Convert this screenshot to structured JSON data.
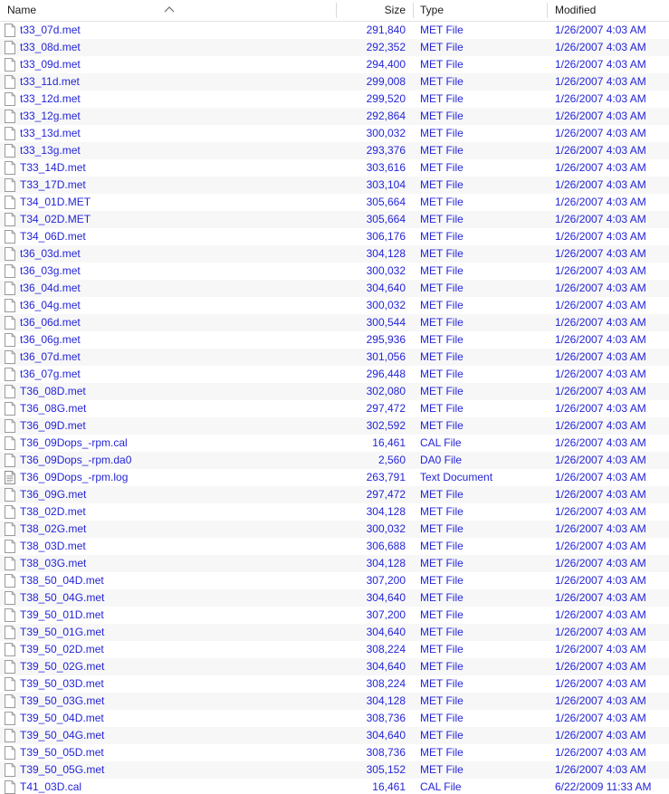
{
  "columns": {
    "name": "Name",
    "size": "Size",
    "type": "Type",
    "modified": "Modified",
    "sort_indicator": "sort-ascending-chevron",
    "sorted_by": "Name"
  },
  "theme": {
    "text_color": "#2424d8",
    "header_text_color": "#1b1b1b",
    "background": "#ffffff",
    "alt_row_background": "#f7f7f7",
    "divider_color": "#d9d9d9"
  },
  "files": [
    {
      "name": "t33_07d.met",
      "size": "291,840",
      "type": "MET File",
      "modified": "1/26/2007 4:03 AM",
      "icon": "blank-file-icon"
    },
    {
      "name": "t33_08d.met",
      "size": "292,352",
      "type": "MET File",
      "modified": "1/26/2007 4:03 AM",
      "icon": "blank-file-icon"
    },
    {
      "name": "t33_09d.met",
      "size": "294,400",
      "type": "MET File",
      "modified": "1/26/2007 4:03 AM",
      "icon": "blank-file-icon"
    },
    {
      "name": "t33_11d.met",
      "size": "299,008",
      "type": "MET File",
      "modified": "1/26/2007 4:03 AM",
      "icon": "blank-file-icon"
    },
    {
      "name": "t33_12d.met",
      "size": "299,520",
      "type": "MET File",
      "modified": "1/26/2007 4:03 AM",
      "icon": "blank-file-icon"
    },
    {
      "name": "t33_12g.met",
      "size": "292,864",
      "type": "MET File",
      "modified": "1/26/2007 4:03 AM",
      "icon": "blank-file-icon"
    },
    {
      "name": "t33_13d.met",
      "size": "300,032",
      "type": "MET File",
      "modified": "1/26/2007 4:03 AM",
      "icon": "blank-file-icon"
    },
    {
      "name": "t33_13g.met",
      "size": "293,376",
      "type": "MET File",
      "modified": "1/26/2007 4:03 AM",
      "icon": "blank-file-icon"
    },
    {
      "name": "T33_14D.met",
      "size": "303,616",
      "type": "MET File",
      "modified": "1/26/2007 4:03 AM",
      "icon": "blank-file-icon"
    },
    {
      "name": "T33_17D.met",
      "size": "303,104",
      "type": "MET File",
      "modified": "1/26/2007 4:03 AM",
      "icon": "blank-file-icon"
    },
    {
      "name": "T34_01D.MET",
      "size": "305,664",
      "type": "MET File",
      "modified": "1/26/2007 4:03 AM",
      "icon": "blank-file-icon"
    },
    {
      "name": "T34_02D.MET",
      "size": "305,664",
      "type": "MET File",
      "modified": "1/26/2007 4:03 AM",
      "icon": "blank-file-icon"
    },
    {
      "name": "T34_06D.met",
      "size": "306,176",
      "type": "MET File",
      "modified": "1/26/2007 4:03 AM",
      "icon": "blank-file-icon"
    },
    {
      "name": "t36_03d.met",
      "size": "304,128",
      "type": "MET File",
      "modified": "1/26/2007 4:03 AM",
      "icon": "blank-file-icon"
    },
    {
      "name": "t36_03g.met",
      "size": "300,032",
      "type": "MET File",
      "modified": "1/26/2007 4:03 AM",
      "icon": "blank-file-icon"
    },
    {
      "name": "t36_04d.met",
      "size": "304,640",
      "type": "MET File",
      "modified": "1/26/2007 4:03 AM",
      "icon": "blank-file-icon"
    },
    {
      "name": "t36_04g.met",
      "size": "300,032",
      "type": "MET File",
      "modified": "1/26/2007 4:03 AM",
      "icon": "blank-file-icon"
    },
    {
      "name": "t36_06d.met",
      "size": "300,544",
      "type": "MET File",
      "modified": "1/26/2007 4:03 AM",
      "icon": "blank-file-icon"
    },
    {
      "name": "t36_06g.met",
      "size": "295,936",
      "type": "MET File",
      "modified": "1/26/2007 4:03 AM",
      "icon": "blank-file-icon"
    },
    {
      "name": "t36_07d.met",
      "size": "301,056",
      "type": "MET File",
      "modified": "1/26/2007 4:03 AM",
      "icon": "blank-file-icon"
    },
    {
      "name": "t36_07g.met",
      "size": "296,448",
      "type": "MET File",
      "modified": "1/26/2007 4:03 AM",
      "icon": "blank-file-icon"
    },
    {
      "name": "T36_08D.met",
      "size": "302,080",
      "type": "MET File",
      "modified": "1/26/2007 4:03 AM",
      "icon": "blank-file-icon"
    },
    {
      "name": "T36_08G.met",
      "size": "297,472",
      "type": "MET File",
      "modified": "1/26/2007 4:03 AM",
      "icon": "blank-file-icon"
    },
    {
      "name": "T36_09D.met",
      "size": "302,592",
      "type": "MET File",
      "modified": "1/26/2007 4:03 AM",
      "icon": "blank-file-icon"
    },
    {
      "name": "T36_09Dops_-rpm.cal",
      "size": "16,461",
      "type": "CAL File",
      "modified": "1/26/2007 4:03 AM",
      "icon": "blank-file-icon"
    },
    {
      "name": "T36_09Dops_-rpm.da0",
      "size": "2,560",
      "type": "DA0 File",
      "modified": "1/26/2007 4:03 AM",
      "icon": "blank-file-icon"
    },
    {
      "name": "T36_09Dops_-rpm.log",
      "size": "263,791",
      "type": "Text Document",
      "modified": "1/26/2007 4:03 AM",
      "icon": "text-document-icon"
    },
    {
      "name": "T36_09G.met",
      "size": "297,472",
      "type": "MET File",
      "modified": "1/26/2007 4:03 AM",
      "icon": "blank-file-icon"
    },
    {
      "name": "T38_02D.met",
      "size": "304,128",
      "type": "MET File",
      "modified": "1/26/2007 4:03 AM",
      "icon": "blank-file-icon"
    },
    {
      "name": "T38_02G.met",
      "size": "300,032",
      "type": "MET File",
      "modified": "1/26/2007 4:03 AM",
      "icon": "blank-file-icon"
    },
    {
      "name": "T38_03D.met",
      "size": "306,688",
      "type": "MET File",
      "modified": "1/26/2007 4:03 AM",
      "icon": "blank-file-icon"
    },
    {
      "name": "T38_03G.met",
      "size": "304,128",
      "type": "MET File",
      "modified": "1/26/2007 4:03 AM",
      "icon": "blank-file-icon"
    },
    {
      "name": "T38_50_04D.met",
      "size": "307,200",
      "type": "MET File",
      "modified": "1/26/2007 4:03 AM",
      "icon": "blank-file-icon"
    },
    {
      "name": "T38_50_04G.met",
      "size": "304,640",
      "type": "MET File",
      "modified": "1/26/2007 4:03 AM",
      "icon": "blank-file-icon"
    },
    {
      "name": "T39_50_01D.met",
      "size": "307,200",
      "type": "MET File",
      "modified": "1/26/2007 4:03 AM",
      "icon": "blank-file-icon"
    },
    {
      "name": "T39_50_01G.met",
      "size": "304,640",
      "type": "MET File",
      "modified": "1/26/2007 4:03 AM",
      "icon": "blank-file-icon"
    },
    {
      "name": "T39_50_02D.met",
      "size": "308,224",
      "type": "MET File",
      "modified": "1/26/2007 4:03 AM",
      "icon": "blank-file-icon"
    },
    {
      "name": "T39_50_02G.met",
      "size": "304,640",
      "type": "MET File",
      "modified": "1/26/2007 4:03 AM",
      "icon": "blank-file-icon"
    },
    {
      "name": "T39_50_03D.met",
      "size": "308,224",
      "type": "MET File",
      "modified": "1/26/2007 4:03 AM",
      "icon": "blank-file-icon"
    },
    {
      "name": "T39_50_03G.met",
      "size": "304,128",
      "type": "MET File",
      "modified": "1/26/2007 4:03 AM",
      "icon": "blank-file-icon"
    },
    {
      "name": "T39_50_04D.met",
      "size": "308,736",
      "type": "MET File",
      "modified": "1/26/2007 4:03 AM",
      "icon": "blank-file-icon"
    },
    {
      "name": "T39_50_04G.met",
      "size": "304,640",
      "type": "MET File",
      "modified": "1/26/2007 4:03 AM",
      "icon": "blank-file-icon"
    },
    {
      "name": "T39_50_05D.met",
      "size": "308,736",
      "type": "MET File",
      "modified": "1/26/2007 4:03 AM",
      "icon": "blank-file-icon"
    },
    {
      "name": "T39_50_05G.met",
      "size": "305,152",
      "type": "MET File",
      "modified": "1/26/2007 4:03 AM",
      "icon": "blank-file-icon"
    },
    {
      "name": "T41_03D.cal",
      "size": "16,461",
      "type": "CAL File",
      "modified": "6/22/2009 11:33 AM",
      "icon": "blank-file-icon"
    }
  ]
}
